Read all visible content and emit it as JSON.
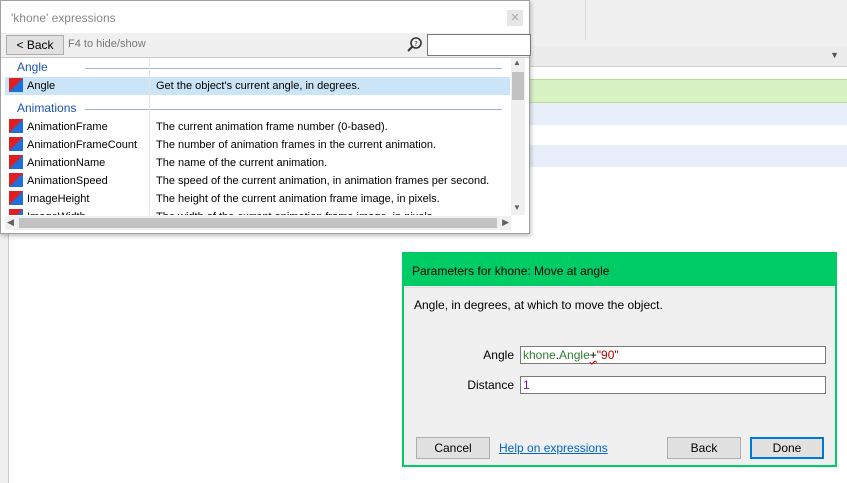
{
  "background": {
    "row_colors": [
      "#d9f2c4",
      "#e8eefa",
      "#e8eefa"
    ]
  },
  "expressions_panel": {
    "title": "'khone' expressions",
    "close_icon": "close-icon",
    "back_label": "< Back",
    "hint": "F4 to hide/show",
    "search_icon": "search-icon",
    "search_value": "",
    "categories": [
      {
        "label": "Angle",
        "items": [
          {
            "name": "Angle",
            "desc": "Get the object's current angle, in degrees.",
            "selected": true
          }
        ]
      },
      {
        "label": "Animations",
        "items": [
          {
            "name": "AnimationFrame",
            "desc": "The current animation frame number (0-based)."
          },
          {
            "name": "AnimationFrameCount",
            "desc": "The number of animation frames in the current animation."
          },
          {
            "name": "AnimationName",
            "desc": "The name of the current animation."
          },
          {
            "name": "AnimationSpeed",
            "desc": "The speed of the current animation, in animation frames per second."
          },
          {
            "name": "ImageHeight",
            "desc": "The height of the current animation frame image, in pixels."
          },
          {
            "name": "ImageWidth",
            "desc": "The width of the current animation frame image, in pixels."
          }
        ]
      }
    ]
  },
  "params_dialog": {
    "title": "Parameters for khone: Move at angle",
    "description": "Angle, in degrees, at which to move the object.",
    "angle_label": "Angle",
    "angle_obj": "khone",
    "angle_dot": ".",
    "angle_expr": "Angle",
    "angle_op": "+",
    "angle_str": "\"90\"",
    "distance_label": "Distance",
    "distance_value": "1",
    "cancel_label": "Cancel",
    "help_label": "Help on expressions",
    "back_label": "Back",
    "done_label": "Done"
  },
  "colors": {
    "dialog_accent": "#00cc66",
    "selection": "#cce4f7",
    "category_text": "#1a56b0"
  }
}
